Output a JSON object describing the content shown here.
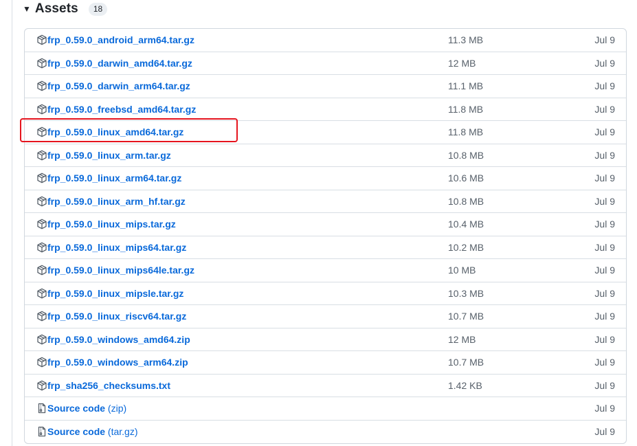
{
  "section": {
    "title": "Assets",
    "count": "18"
  },
  "assets": [
    {
      "name": "frp_0.59.0_android_arm64.tar.gz",
      "size": "11.3 MB",
      "date": "Jul 9"
    },
    {
      "name": "frp_0.59.0_darwin_amd64.tar.gz",
      "size": "12 MB",
      "date": "Jul 9"
    },
    {
      "name": "frp_0.59.0_darwin_arm64.tar.gz",
      "size": "11.1 MB",
      "date": "Jul 9"
    },
    {
      "name": "frp_0.59.0_freebsd_amd64.tar.gz",
      "size": "11.8 MB",
      "date": "Jul 9"
    },
    {
      "name": "frp_0.59.0_linux_amd64.tar.gz",
      "size": "11.8 MB",
      "date": "Jul 9"
    },
    {
      "name": "frp_0.59.0_linux_arm.tar.gz",
      "size": "10.8 MB",
      "date": "Jul 9"
    },
    {
      "name": "frp_0.59.0_linux_arm64.tar.gz",
      "size": "10.6 MB",
      "date": "Jul 9"
    },
    {
      "name": "frp_0.59.0_linux_arm_hf.tar.gz",
      "size": "10.8 MB",
      "date": "Jul 9"
    },
    {
      "name": "frp_0.59.0_linux_mips.tar.gz",
      "size": "10.4 MB",
      "date": "Jul 9"
    },
    {
      "name": "frp_0.59.0_linux_mips64.tar.gz",
      "size": "10.2 MB",
      "date": "Jul 9"
    },
    {
      "name": "frp_0.59.0_linux_mips64le.tar.gz",
      "size": "10 MB",
      "date": "Jul 9"
    },
    {
      "name": "frp_0.59.0_linux_mipsle.tar.gz",
      "size": "10.3 MB",
      "date": "Jul 9"
    },
    {
      "name": "frp_0.59.0_linux_riscv64.tar.gz",
      "size": "10.7 MB",
      "date": "Jul 9"
    },
    {
      "name": "frp_0.59.0_windows_amd64.zip",
      "size": "12 MB",
      "date": "Jul 9"
    },
    {
      "name": "frp_0.59.0_windows_arm64.zip",
      "size": "10.7 MB",
      "date": "Jul 9"
    },
    {
      "name": "frp_sha256_checksums.txt",
      "size": "1.42 KB",
      "date": "Jul 9"
    }
  ],
  "source_code": [
    {
      "label": "Source code",
      "suffix": "(zip)",
      "date": "Jul 9"
    },
    {
      "label": "Source code",
      "suffix": "(tar.gz)",
      "date": "Jul 9"
    }
  ],
  "icons": {
    "asset": "package-icon",
    "source": "file-zip-icon",
    "toggle": "triangle-down-icon"
  },
  "colors": {
    "link": "#0969da",
    "muted": "#57606a",
    "highlight": "#e5141e"
  }
}
